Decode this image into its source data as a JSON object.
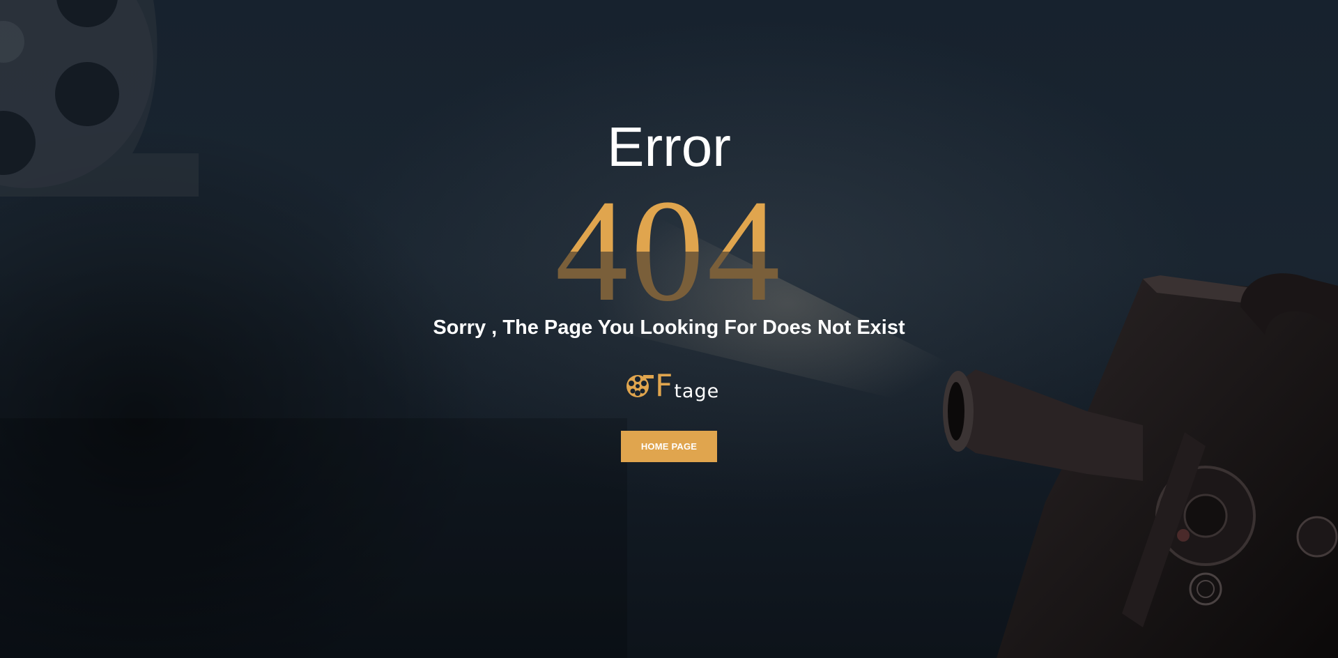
{
  "error": {
    "title": "Error",
    "code": "404",
    "message": "Sorry , The Page You Looking For Does Not Exist"
  },
  "logo": {
    "icon": "film-reel-icon",
    "letter": "F",
    "suffix": "tage"
  },
  "home_button": {
    "label": "HOME PAGE"
  },
  "colors": {
    "accent": "#e0a54e",
    "accent_dim": "#7a5f3a",
    "text": "#ffffff",
    "background": "#17222e"
  },
  "background": {
    "left_decoration": "film-reel-icon",
    "right_decoration": "projector-icon"
  }
}
